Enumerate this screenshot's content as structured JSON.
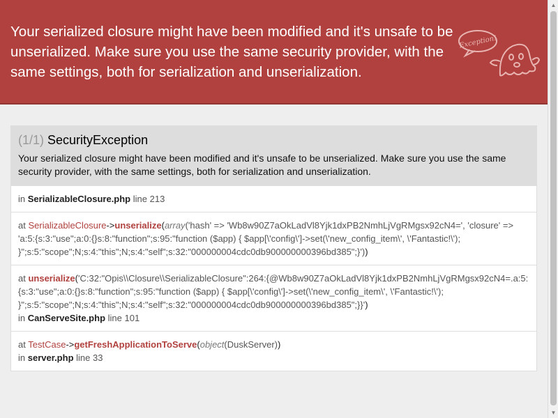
{
  "header": {
    "message": "Your serialized closure might have been modified and it's unsafe to be unserialized. Make sure you use the same security provider, with the same settings, both for serialization and unserialization.",
    "mascot": {
      "icon": "ghost-icon",
      "bubble_text": "Exception!"
    }
  },
  "exception": {
    "count": "(1/1)",
    "class": "SecurityException",
    "message": "Your serialized closure might have been modified and it's unsafe to be unserialized. Make sure you use the same security provider, with the same settings, both for serialization and unserialization."
  },
  "trace": {
    "origin": {
      "in_label": "in",
      "file": "SerializableClosure.php",
      "line_label": "line",
      "line": "213"
    },
    "frames": [
      {
        "at_label": "at",
        "class": "SerializableClosure",
        "arrow": "->",
        "method": "unserialize",
        "open": "(",
        "arg_type": "array",
        "arg": "('hash' => 'Wb8w90Z7aOkLadVl8Yjk1dxPB2NmhLjVgRMgsx92cN4=', 'closure' => 'a:5:{s:3:\"use\";a:0:{}s:8:\"function\";s:95:\"function ($app) { $app[\\'config\\']->set(\\'new_config_item\\', \\'Fantastic!\\'); }\";s:5:\"scope\";N;s:4:\"this\";N;s:4:\"self\";s:32:\"000000004cdc0db900000000396bd385\";}')",
        "close": ")"
      },
      {
        "at_label": "at",
        "method": "unserialize",
        "open": "(",
        "arg": "'C:32:\"Opis\\\\Closure\\\\SerializableClosure\":264:{@Wb8w90Z7aOkLadVl8Yjk1dxPB2NmhLjVgRMgsx92cN4=.a:5:{s:3:\"use\";a:0:{}s:8:\"function\";s:95:\"function ($app) { $app[\\'config\\']->set(\\'new_config_item\\', \\'Fantastic!\\'); }\";s:5:\"scope\";N;s:4:\"this\";N;s:4:\"self\";s:32:\"000000004cdc0db900000000396bd385\";}}'",
        "close": ")",
        "in_label": "in",
        "file": "CanServeSite.php",
        "line_label": "line",
        "line": "101"
      },
      {
        "at_label": "at",
        "class": "TestCase",
        "arrow": "->",
        "method": "getFreshApplicationToServe",
        "open": "(",
        "arg_type": "object",
        "arg": "(DuskServer)",
        "close": ")",
        "in_label": "in",
        "file": "server.php",
        "line_label": "line",
        "line": "33"
      }
    ]
  },
  "scrollbar": {
    "up_icon": "scroll-up-arrow-icon",
    "down_icon": "scroll-down-arrow-icon"
  },
  "colors": {
    "header_bg": "#b0413e",
    "accent": "#b0413e",
    "panel_head_bg": "#dddddd",
    "page_bg": "#eeeeee"
  }
}
